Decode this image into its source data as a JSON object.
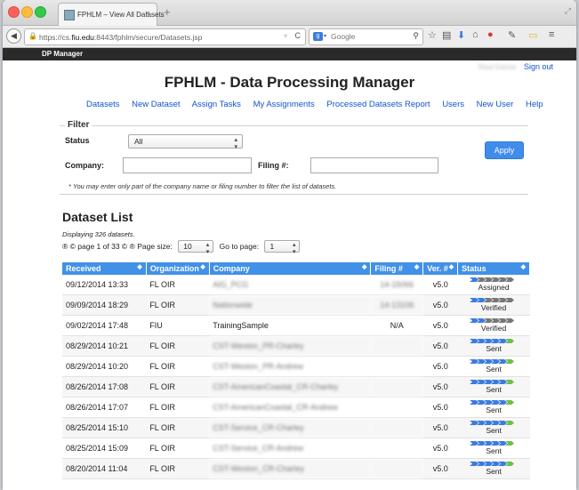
{
  "browser": {
    "tab_title": "FPHLM – View All Datasets",
    "tab_close": "×",
    "newtab": "+",
    "url_prefix": "https://cs.",
    "url_domain": "fiu.edu",
    "url_suffix": ":8443/fphlm/secure/Datasets.jsp",
    "search_engine_letter": "g",
    "search_placeholder": "Google",
    "icons": [
      "star-icon",
      "bookmarks-icon",
      "download-icon",
      "home-icon",
      "abp-icon",
      "tools-icon",
      "chat-icon",
      "menu-icon"
    ]
  },
  "appbar": {
    "title": "DP Manager"
  },
  "header": {
    "user_name": "Raul Garcia",
    "signout": "Sign out",
    "title": "FPHLM - Data Processing Manager"
  },
  "menu": [
    "Datasets",
    "New Dataset",
    "Assign Tasks",
    "My Assignments",
    "Processed Datasets Report",
    "Users",
    "New User",
    "Help"
  ],
  "filter": {
    "legend": "Filter",
    "status_label": "Status",
    "status_value": "All",
    "company_label": "Company:",
    "filing_label": "Filing #:",
    "note": "* You may enter only part of the company name or filing number to filter the list of datasets.",
    "apply": "Apply"
  },
  "list": {
    "title": "Dataset List",
    "displaying": "Displaying 326 datasets.",
    "page_text": "page 1 of 33",
    "page_size_label": "Page size:",
    "page_size": "10",
    "goto_label": "Go to page:",
    "goto_value": "1"
  },
  "table": {
    "columns": [
      "Received",
      "Organization",
      "Company",
      "Filing #",
      "Ver. #",
      "Status"
    ],
    "rows": [
      {
        "received": "09/12/2014 13:33",
        "org": "FL OIR",
        "company": "AIG_PCG",
        "filing": "14-15066",
        "ver": "v5.0",
        "status": "Assigned",
        "progress": 1
      },
      {
        "received": "09/09/2014 18:29",
        "org": "FL OIR",
        "company": "Nationwide",
        "filing": "14-13106",
        "ver": "v5.0",
        "status": "Verified",
        "progress": 2
      },
      {
        "received": "09/02/2014 17:48",
        "org": "FIU",
        "company": "TrainingSample",
        "filing": "N/A",
        "ver": "v5.0",
        "status": "Verified",
        "progress": 2
      },
      {
        "received": "08/29/2014 10:21",
        "org": "FL OIR",
        "company": "CST-Weston_PR-Charley",
        "filing": "",
        "ver": "v5.0",
        "status": "Sent",
        "progress": 6
      },
      {
        "received": "08/29/2014 10:20",
        "org": "FL OIR",
        "company": "CST-Weston_PR-Andrew",
        "filing": "",
        "ver": "v5.0",
        "status": "Sent",
        "progress": 6
      },
      {
        "received": "08/26/2014 17:08",
        "org": "FL OIR",
        "company": "CST-AmericanCoastal_CR-Charley",
        "filing": "",
        "ver": "v5.0",
        "status": "Sent",
        "progress": 6
      },
      {
        "received": "08/26/2014 17:07",
        "org": "FL OIR",
        "company": "CST-AmericanCoastal_CR-Andrew",
        "filing": "",
        "ver": "v5.0",
        "status": "Sent",
        "progress": 6
      },
      {
        "received": "08/25/2014 15:10",
        "org": "FL OIR",
        "company": "CST-Service_CR-Charley",
        "filing": "",
        "ver": "v5.0",
        "status": "Sent",
        "progress": 6
      },
      {
        "received": "08/25/2014 15:09",
        "org": "FL OIR",
        "company": "CST-Service_CR-Andrew",
        "filing": "",
        "ver": "v5.0",
        "status": "Sent",
        "progress": 6
      },
      {
        "received": "08/20/2014 11:04",
        "org": "FL OIR",
        "company": "CST-Weston_CR-Charley",
        "filing": "",
        "ver": "v5.0",
        "status": "Sent",
        "progress": 6
      }
    ]
  }
}
